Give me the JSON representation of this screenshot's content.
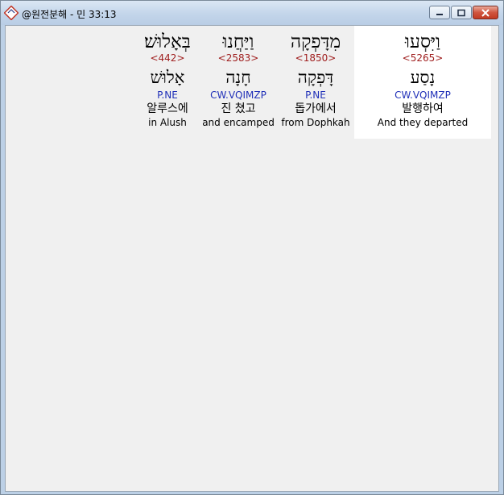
{
  "window": {
    "title": "@원전분해 - 민 33:13",
    "icon": "app-icon",
    "controls": [
      "minimize",
      "maximize",
      "close"
    ]
  },
  "words": [
    {
      "hebrew": "וַיִּסְעוּ",
      "strong": "<5265>",
      "lemma": "נָסַע",
      "parsing": "CW.VQIMZP",
      "korean": "발행하여",
      "english": "And they departed",
      "selected": true
    },
    {
      "hebrew": "מִדָּפְקָה",
      "strong": "<1850>",
      "lemma": "דָּפְקָה",
      "parsing": "P.NE",
      "korean": "돕가에서",
      "english": "from Dophkah",
      "selected": false
    },
    {
      "hebrew": "וַיַּחֲנוּ",
      "strong": "<2583>",
      "lemma": "חָנָה",
      "parsing": "CW.VQIMZP",
      "korean": "진 쳤고",
      "english": "and encamped",
      "selected": false
    },
    {
      "hebrew": "בְּאָלוּשׁ׃",
      "strong": "<442>",
      "lemma": "אָלוּשׁ",
      "parsing": "P.NE",
      "korean": "알루스에",
      "english": "in Alush",
      "selected": false
    }
  ]
}
